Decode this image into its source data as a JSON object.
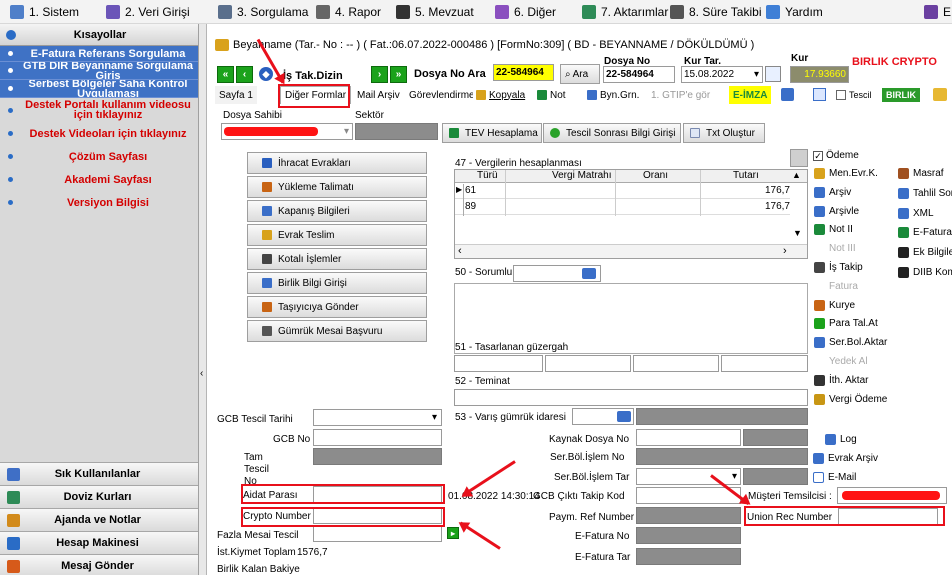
{
  "menubar": {
    "items": [
      {
        "label": "1. Sistem",
        "icon": "system-icon",
        "color": "#4f7fc9"
      },
      {
        "label": "2. Veri Girişi",
        "icon": "data-entry-icon",
        "color": "#6b55b8"
      },
      {
        "label": "3. Sorgulama",
        "icon": "query-icon",
        "color": "#5a6f8c"
      },
      {
        "label": "4. Rapor",
        "icon": "report-icon",
        "color": "#666666"
      },
      {
        "label": "5. Mevzuat",
        "icon": "legislation-icon",
        "color": "#333333"
      },
      {
        "label": "6. Diğer",
        "icon": "other-icon",
        "color": "#8a4fbf"
      },
      {
        "label": "7. Aktarımlar",
        "icon": "transfers-icon",
        "color": "#2e8b57"
      },
      {
        "label": "8. Süre Takibi",
        "icon": "calendar-icon",
        "color": "#555555"
      },
      {
        "label": "Yardım",
        "icon": "help-icon",
        "color": "#3f7fd6"
      },
      {
        "label": "E",
        "icon": "exit-icon",
        "color": "#6a3fa0"
      }
    ]
  },
  "sidebar": {
    "header": "Kısayollar",
    "blue_links": [
      "E-Fatura Referans Sorgulama",
      "GTB DIR Beyanname Sorgulama Giriş",
      "Serbest Bölgeler Saha Kontrol Uygulaması"
    ],
    "red_links": [
      "Destek Portalı kullanım videosu için tıklayınız",
      "Destek Videoları için tıklayınız",
      "Çözüm Sayfası",
      "Akademi Sayfası",
      "Versiyon Bilgisi"
    ],
    "bottom_items": [
      {
        "label": "Sık Kullanılanlar",
        "icon": "favorites-icon",
        "color": "#3f6fc6"
      },
      {
        "label": "Doviz Kurları",
        "icon": "currency-icon",
        "color": "#2e8b57"
      },
      {
        "label": "Ajanda ve Notlar",
        "icon": "agenda-icon",
        "color": "#d28a1a"
      },
      {
        "label": "Hesap Makinesi",
        "icon": "calculator-icon",
        "color": "#2a6cc6"
      },
      {
        "label": "Mesaj Gönder",
        "icon": "message-icon",
        "color": "#d65a1a"
      }
    ]
  },
  "title": {
    "text": "Beyanname (Tar.- No : -- ) ( Fat.:06.07.2022-000486 ) [FormNo:309] ( BD - BEYANNAME / DÖKÜLDÜMÜ )"
  },
  "toolbar": {
    "is_takdizin": "İş Tak.Dizin",
    "dosya_no_ara": "Dosya No Ara",
    "ara_value": "22-584964",
    "ara_button": "Ara",
    "dosya_no_label": "Dosya No",
    "dosya_no_value": "22-584964",
    "kur_tar_label": "Kur Tar.",
    "kur_tar_value": "15.08.2022",
    "kur_label": "Kur",
    "kur_value": "17.93660",
    "company": "BIRLIK CRYPTO"
  },
  "tabs": [
    "Sayfa 1",
    "Diğer Formlar",
    "Mail Arşiv",
    "Görevlendirme",
    "Kopyala",
    "Not",
    "Byn.Grn.",
    "1. GTIP'e gör",
    "E-İMZA",
    "Tescil",
    "BIRLIK"
  ],
  "row_dosya": {
    "dosya_sahibi": "Dosya Sahibi",
    "sektor": "Sektör",
    "tev_button": "TEV Hesaplama",
    "tescil_button": "Tescil Sonrası Bilgi Girişi",
    "txt_button": "Txt Oluştur"
  },
  "left_buttons": [
    "İhracat Evrakları",
    "Yükleme Talimatı",
    "Kapanış Bilgileri",
    "Evrak Teslim",
    "Kotalı İşlemler",
    "Birlik Bilgi Girişi",
    "Taşıyıcıya Gönder",
    "Gümrük Mesai Başvuru"
  ],
  "vergi": {
    "title": "47 - Vergilerin hesaplanması",
    "columns": [
      "Türü",
      "Vergi Matrahı",
      "Oranı",
      "Tutarı"
    ],
    "rows": [
      {
        "type": "61",
        "matrah": "",
        "oran": "",
        "tutar": "176,7"
      },
      {
        "type": "89",
        "matrah": "",
        "oran": "",
        "tutar": "176,7"
      }
    ]
  },
  "labels": {
    "sorumlu": "50 - Sorumlu",
    "tasarlanan": "51 - Tasarlanan güzergah",
    "teminat": "52 - Teminat",
    "varis": "53 - Varış gümrük idaresi",
    "gcb_tescil_tarihi": "GCB Tescil Tarihi",
    "gcb_no": "GCB No",
    "tam_tescil_no": "Tam Tescil No",
    "aidat_parasi": "Aidat Parası",
    "crypto_number": "Crypto Number",
    "fazla_mesai": "Fazla Mesai Tescil",
    "ist_kiymet": "İst.Kiymet Toplam",
    "ist_kiymet_value": "1576,7",
    "birlik_kalan": "Birlik Kalan Bakiye",
    "kaynak_dosya": "Kaynak Dosya No",
    "ser_bol_islem_no": "Ser.Böl.İşlem No",
    "ser_bol_islem_tar": "Ser.Böl.İşlem Tar",
    "gcb_cikti_value": "01.08.2022 14:30:14",
    "gcb_cikti": "GCB Çıktı Takip Kod",
    "paym_ref": "Paym. Ref Number",
    "efatura_no": "E-Fatura No",
    "efatura_tar": "E-Fatura Tar",
    "musteri_temsilcisi": "Müşteri Temsilcisi :",
    "union_rec": "Union Rec Number",
    "log": "Log",
    "evrak_arsiv": "Evrak Arşiv",
    "email": "E-Mail"
  },
  "right_panel": {
    "odeme": "Ödeme",
    "col1": [
      {
        "label": "Men.Evr.K.",
        "icon": "folder-icon",
        "color": "#d8a21c"
      },
      {
        "label": "Arşiv",
        "icon": "archive-icon",
        "color": "#3a6ec8"
      },
      {
        "label": "Arşivle",
        "icon": "archive-add-icon",
        "color": "#3a6ec8"
      },
      {
        "label": "Not II",
        "icon": "note-icon",
        "color": "#1a8a3a"
      },
      {
        "label": "Not III",
        "icon": "",
        "color": ""
      },
      {
        "label": "İş Takip",
        "icon": "tracking-icon",
        "color": "#444444"
      },
      {
        "label": "Fatura",
        "icon": "",
        "color": ""
      },
      {
        "label": "Kurye",
        "icon": "courier-icon",
        "color": "#c86414"
      },
      {
        "label": "Para Tal.At",
        "icon": "money-icon",
        "color": "#1ba21b"
      },
      {
        "label": "Ser.Bol.Aktar",
        "icon": "transfer-icon",
        "color": "#3a6ec8"
      },
      {
        "label": "Yedek Al",
        "icon": "backup-icon",
        "color": ""
      },
      {
        "label": "İth. Aktar",
        "icon": "import-icon",
        "color": "#333333"
      },
      {
        "label": "Vergi Ödeme",
        "icon": "tax-icon",
        "color": "#c89614"
      }
    ],
    "col2": [
      {
        "label": "Masraf",
        "icon": "expense-icon",
        "color": "#a05020"
      },
      {
        "label": "Tahlil Sonuç",
        "icon": "analysis-icon",
        "color": "#3a6ec8"
      },
      {
        "label": "XML",
        "icon": "xml-icon",
        "color": "#3a6ec8"
      },
      {
        "label": "E-Fatura",
        "icon": "efatura-icon",
        "color": "#1a8a3a"
      },
      {
        "label": "Ek Bilgiler",
        "icon": "info-icon",
        "color": "#222222"
      },
      {
        "label": "DIIB Komp.",
        "icon": "diib-icon",
        "color": "#222222"
      }
    ]
  },
  "colors": {
    "accent_red": "#e8101b",
    "sidebar_blue": "#3f72c5",
    "yellow": "#ffff00"
  }
}
